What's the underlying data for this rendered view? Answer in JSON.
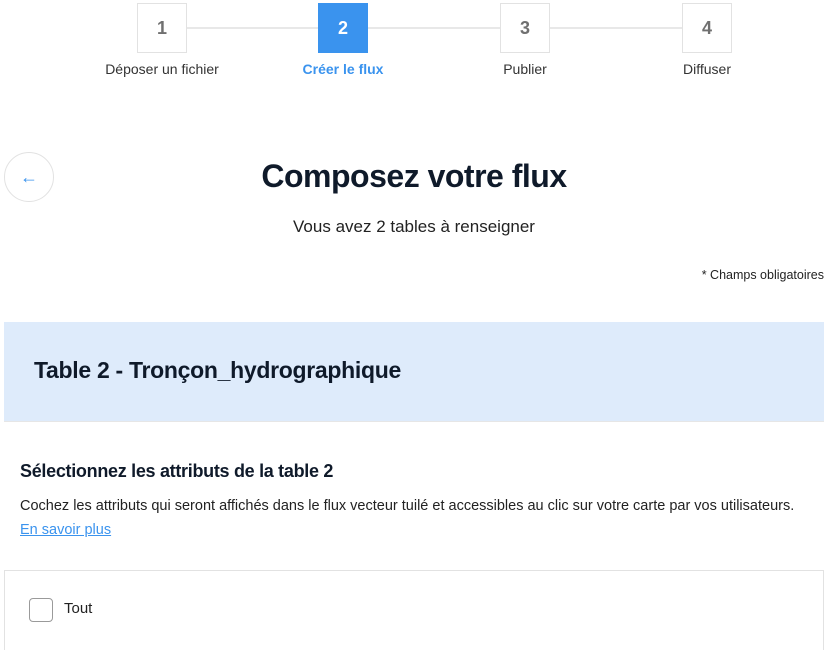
{
  "stepper": {
    "steps": [
      {
        "number": "1",
        "label": "Déposer un fichier",
        "active": false
      },
      {
        "number": "2",
        "label": "Créer le flux",
        "active": true
      },
      {
        "number": "3",
        "label": "Publier",
        "active": false
      },
      {
        "number": "4",
        "label": "Diffuser",
        "active": false
      }
    ],
    "accent_color": "#3a93ee"
  },
  "back_button": {
    "icon": "arrow-left-icon"
  },
  "header": {
    "title": "Composez votre flux",
    "subtitle": "Vous avez 2 tables à renseigner",
    "required_note": "* Champs obligatoires"
  },
  "table": {
    "title": "Table 2 - Tronçon_hydrographique"
  },
  "section": {
    "heading": "Sélectionnez les attributs de la table 2",
    "description": "Cochez les attributs qui seront affichés dans le flux vecteur tuilé et accessibles au clic sur votre carte par vos utilisateurs.",
    "link": "En savoir plus"
  },
  "attributes": {
    "all_label": "Tout",
    "all_checked": false
  }
}
